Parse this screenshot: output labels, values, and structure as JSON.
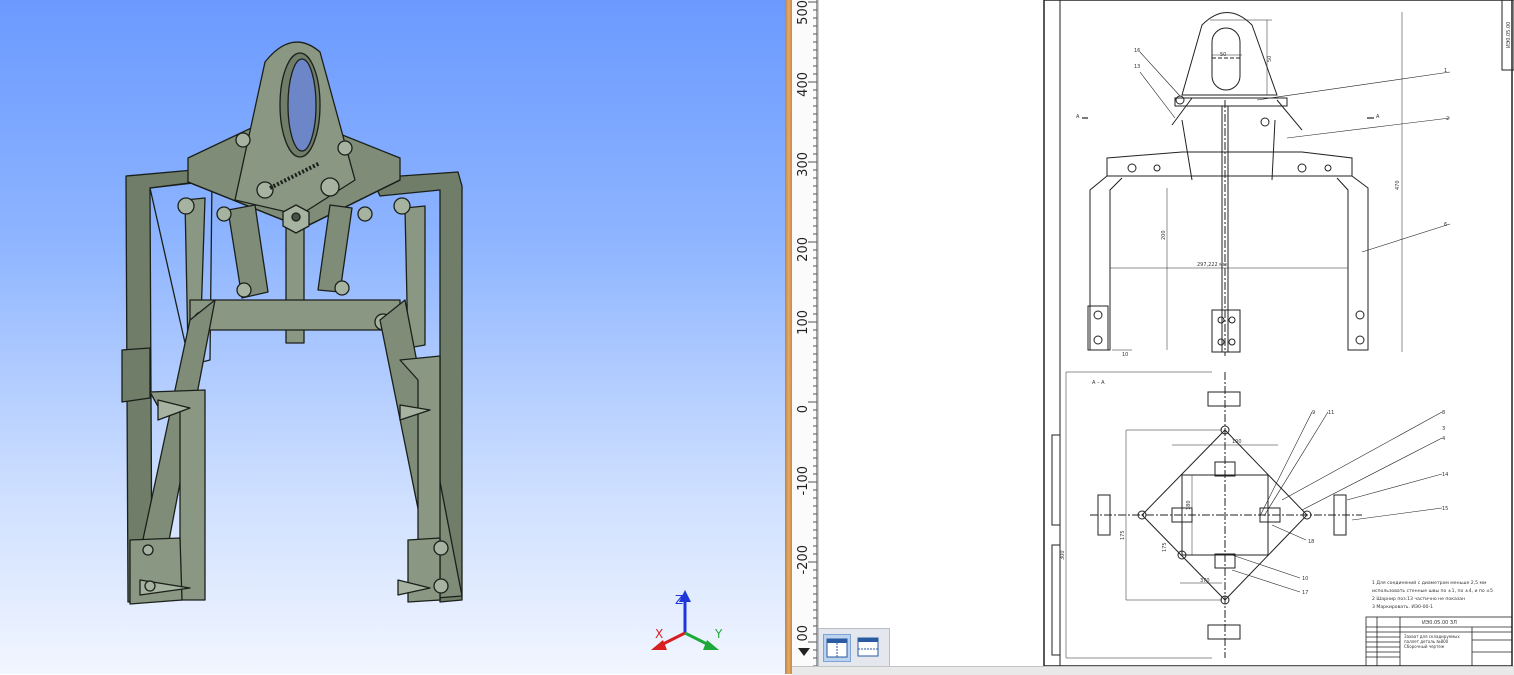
{
  "viewport": {
    "background_top": "#6b9aff",
    "background_bottom": "#f2f6ff",
    "part_color": "#7f8d78",
    "axes": {
      "x_label": "X",
      "y_label": "Y",
      "z_label": "Z",
      "x_color": "#d81e1e",
      "y_color": "#1fa83a",
      "z_color": "#1f36d8"
    }
  },
  "ruler": {
    "labels": [
      "500",
      "400",
      "300",
      "200",
      "100",
      "0",
      "-100",
      "-200",
      "00"
    ],
    "scroll_icon": "triangle-down-icon"
  },
  "view_toolbar": {
    "buttons": [
      {
        "icon": "vertical-split-icon",
        "active": true
      },
      {
        "icon": "horizontal-split-icon",
        "active": false
      }
    ]
  },
  "drawing": {
    "stamp_text": "ИЭ0.05.00",
    "section_label": "А – А",
    "section_mark_left": "А",
    "section_mark_right": "А",
    "dim_top_width": "50",
    "dim_top_height": "50",
    "dim_span": "297,222 мм",
    "dim_leg_height": "200",
    "dim_total_height": "470",
    "dim_small": "10",
    "dim_plan_width": "100",
    "dim_plan_height": "180",
    "dim_plan_b": "175",
    "dim_plan_c": "175",
    "dim_plan_total": "300",
    "dim_plan_bottom": "370",
    "callouts_right": [
      "1",
      "2",
      "6",
      "8",
      "3",
      "4",
      "14",
      "15",
      "9",
      "11",
      "10",
      "17",
      "18"
    ],
    "callouts_left": [
      "16",
      "13"
    ],
    "notes": [
      "1 Для соединений с диаметром меньше 2,5 мм",
      "использовать стенные швы по ±1, по ±4, и по ±5",
      "2 Шарнир поз.13 частично не показан",
      "3 Маркировать. ИЭ0-00-1"
    ],
    "title_block": {
      "code": "ИЭ0.05.00 ЗЛ",
      "name_line1": "Захват для складируемых",
      "name_line2": "паллет деталь №800",
      "name_line3": "Сборочный чертеж"
    }
  }
}
